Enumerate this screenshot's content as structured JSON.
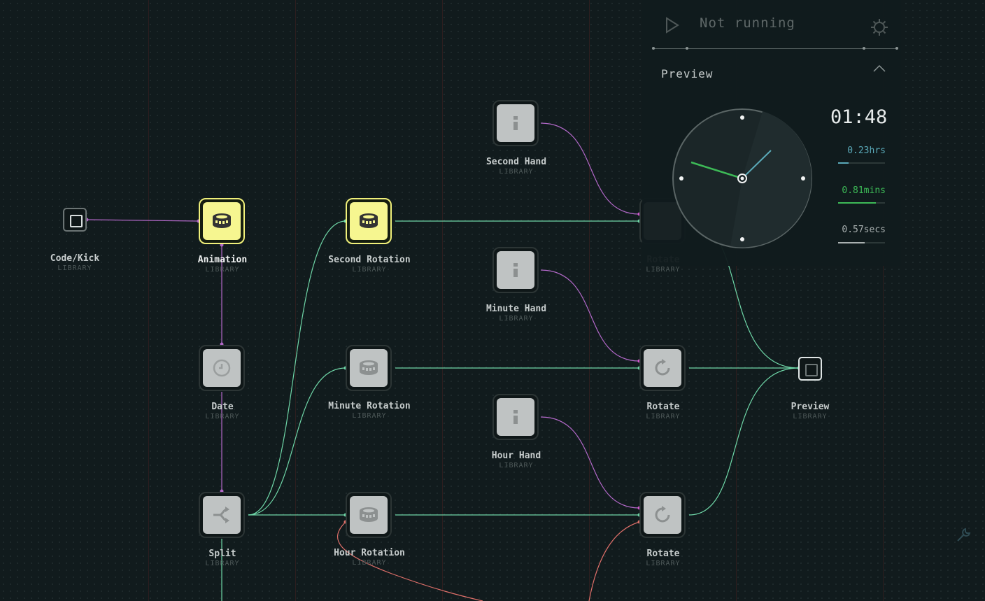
{
  "runner": {
    "status": "Not running"
  },
  "preview_panel": {
    "title": "Preview",
    "time": "01:48",
    "metrics": [
      {
        "text": "0.23hrs",
        "value": 0.23,
        "color": "#5aa9b8"
      },
      {
        "text": "0.81mins",
        "value": 0.81,
        "color": "#3dba57"
      },
      {
        "text": "0.57secs",
        "value": 0.57,
        "color": "#a9b0b0"
      }
    ]
  },
  "nodes": {
    "code_kick": {
      "name": "Code/Kick",
      "sub": "LIBRARY"
    },
    "animation": {
      "name": "Animation",
      "sub": "LIBRARY"
    },
    "date": {
      "name": "Date",
      "sub": "LIBRARY"
    },
    "split": {
      "name": "Split",
      "sub": "LIBRARY"
    },
    "second_rotation": {
      "name": "Second Rotation",
      "sub": "LIBRARY"
    },
    "minute_rotation": {
      "name": "Minute Rotation",
      "sub": "LIBRARY"
    },
    "hour_rotation": {
      "name": "Hour Rotation",
      "sub": "LIBRARY"
    },
    "second_hand": {
      "name": "Second Hand",
      "sub": "LIBRARY"
    },
    "minute_hand": {
      "name": "Minute Hand",
      "sub": "LIBRARY"
    },
    "hour_hand": {
      "name": "Hour Hand",
      "sub": "LIBRARY"
    },
    "rotate_1": {
      "name": "Rotate",
      "sub": "LIBRARY"
    },
    "rotate_2": {
      "name": "Rotate",
      "sub": "LIBRARY"
    },
    "rotate_3": {
      "name": "Rotate",
      "sub": "LIBRARY"
    },
    "preview": {
      "name": "Preview",
      "sub": "LIBRARY"
    }
  },
  "colors": {
    "background": "#111b1d",
    "wire_green": "#6fd7a8",
    "wire_purple": "#b268c8",
    "wire_red": "#e0706a",
    "active_node": "#f6f690",
    "node_face": "#bfc3c3"
  },
  "icons": {
    "play": "play-icon",
    "settings": "gear-icon",
    "collapse": "chevron-up-icon",
    "animation": "film-reel-icon",
    "date": "clock-icon",
    "split": "split-arrows-icon",
    "info": "info-icon",
    "rotate": "rotate-icon",
    "tool": "wrench-icon"
  }
}
